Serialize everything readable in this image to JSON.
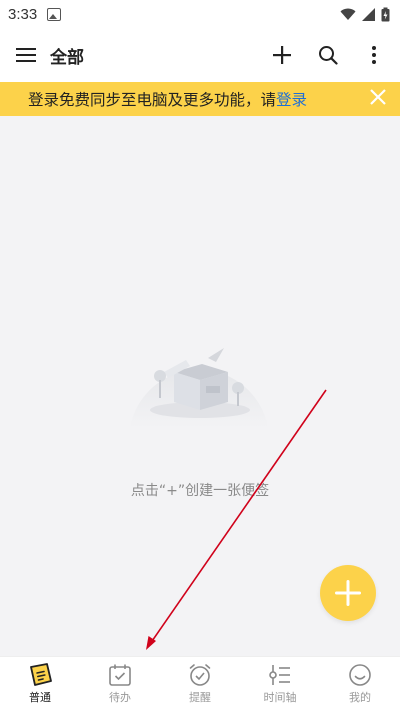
{
  "status": {
    "time": "3:33"
  },
  "toolbar": {
    "title": "全部"
  },
  "banner": {
    "text": "登录免费同步至电脑及更多功能，请",
    "link": "登录"
  },
  "empty": {
    "message": "点击“+”创建一张便签"
  },
  "tabs": [
    {
      "label": "普通",
      "icon": "note-icon",
      "active": true
    },
    {
      "label": "待办",
      "icon": "todo-icon",
      "active": false
    },
    {
      "label": "提醒",
      "icon": "alarm-icon",
      "active": false
    },
    {
      "label": "时间轴",
      "icon": "timeline-icon",
      "active": false
    },
    {
      "label": "我的",
      "icon": "smile-icon",
      "active": false
    }
  ],
  "colors": {
    "accent": "#fcd24a",
    "link": "#1e6fd6",
    "annotation_arrow": "#d0021b"
  }
}
